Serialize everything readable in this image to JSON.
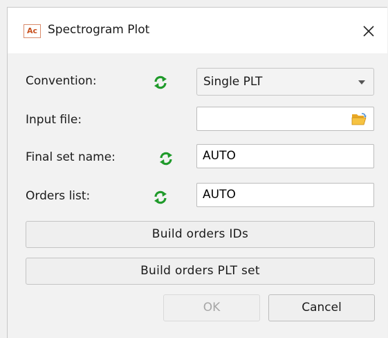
{
  "window": {
    "app_icon_text": "Ac",
    "title": "Spectrogram Plot"
  },
  "form": {
    "convention": {
      "label": "Convention:",
      "value": "Single PLT"
    },
    "input_file": {
      "label": "Input file:",
      "value": ""
    },
    "final_set_name": {
      "label": "Final set name:",
      "value": "AUTO"
    },
    "orders_list": {
      "label": "Orders list:",
      "value": "AUTO"
    }
  },
  "buttons": {
    "build_orders_ids": "Build orders IDs",
    "build_orders_plt_set": "Build orders PLT set",
    "ok": "OK",
    "cancel": "Cancel"
  },
  "colors": {
    "refresh_icon": "#1f9a2a",
    "app_icon_accent": "#c8501e",
    "folder_icon": "#f0b030",
    "disabled_text": "#a6a6a6"
  },
  "icons": {
    "refresh": "refresh-icon",
    "close": "close-icon",
    "folder": "folder-open-icon",
    "dropdown": "chevron-down-icon"
  }
}
